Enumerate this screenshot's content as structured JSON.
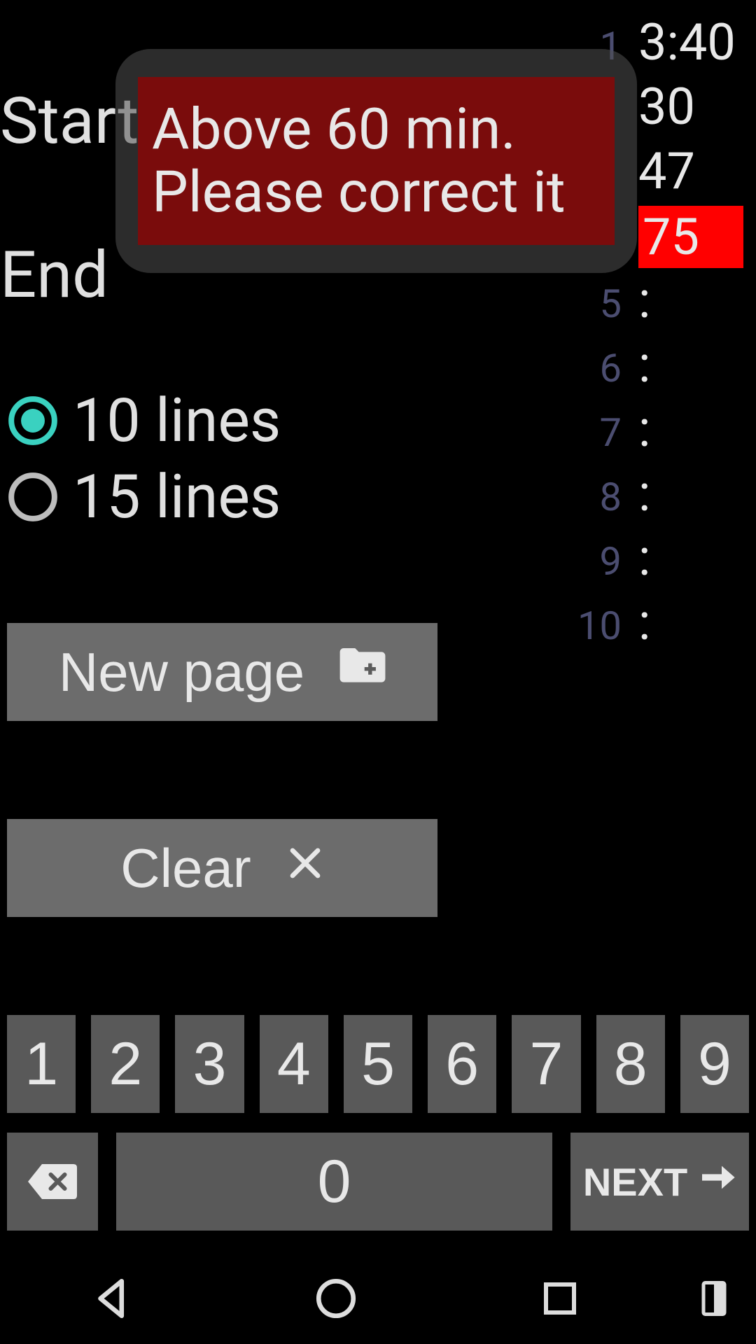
{
  "status": {
    "clock": "3:40"
  },
  "labels": {
    "start": "Start",
    "end": "End"
  },
  "tooltip": {
    "line1": "Above 60 min.",
    "line2": "Please correct it"
  },
  "times": {
    "rows": [
      {
        "idx": "1",
        "val": "3:40"
      },
      {
        "idx": "",
        "val": "30"
      },
      {
        "idx": "",
        "val": "47"
      },
      {
        "idx": "",
        "val": "75",
        "highlight": true
      },
      {
        "idx": "5",
        "val": ":"
      },
      {
        "idx": "6",
        "val": ":"
      },
      {
        "idx": "7",
        "val": ":"
      },
      {
        "idx": "8",
        "val": ":"
      },
      {
        "idx": "9",
        "val": ":"
      },
      {
        "idx": "10",
        "val": ":"
      }
    ]
  },
  "radios": {
    "opt1": "10 lines",
    "opt2": "15 lines",
    "selected": 0
  },
  "buttons": {
    "newpage": "New page",
    "clear": "Clear"
  },
  "keypad": {
    "keys": [
      "1",
      "2",
      "3",
      "4",
      "5",
      "6",
      "7",
      "8",
      "9"
    ],
    "zero": "0",
    "next": "NEXT"
  }
}
